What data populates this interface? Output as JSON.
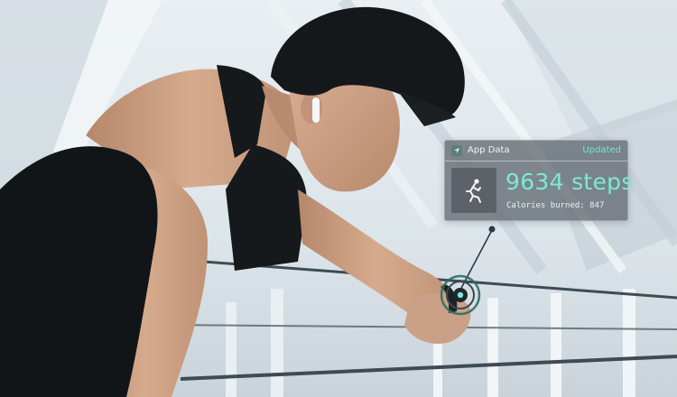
{
  "app_card": {
    "title": "App Data",
    "status": "Updated",
    "steps": "9634 steps",
    "calories": "Calories burned: 847",
    "accent_color": "#7ee8d6",
    "icons": {
      "header": "location-arrow-icon",
      "activity": "running-person-icon"
    }
  },
  "photo": {
    "subject": "man-checking-smartwatch",
    "palette": {
      "sky": "#dfe7ec",
      "shirt": "#141719",
      "skin": "#c99d80",
      "hair": "#15181b"
    }
  }
}
